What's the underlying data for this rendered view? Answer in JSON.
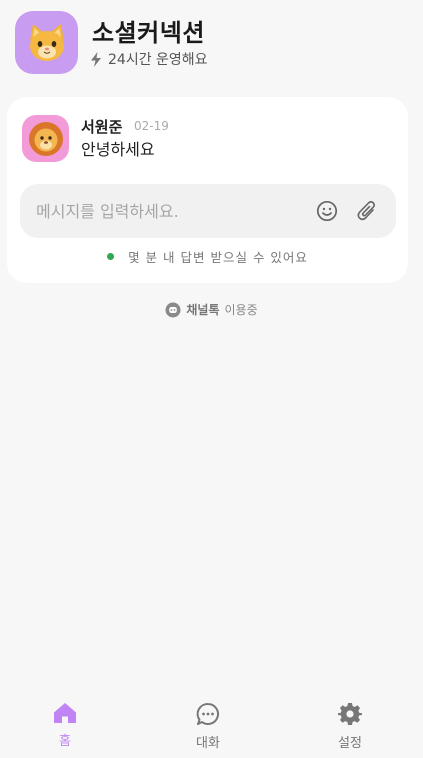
{
  "app": {
    "title": "소셜커넥션",
    "subtitle": "24시간 운영해요",
    "avatar_emoji": "🐱",
    "avatar_color": "#c89cf0"
  },
  "message": {
    "sender": "서원준",
    "date": "02-19",
    "text": "안녕하세요",
    "avatar_emoji": "🦁",
    "avatar_color": "#f29bd8"
  },
  "composer": {
    "placeholder": "메시지를 입력하세요.",
    "value": ""
  },
  "status": {
    "text": "몇 분 내 답변 받으실 수 있어요",
    "dot_color": "#2fa84f"
  },
  "powered_by": {
    "brand": "채널톡",
    "suffix": "이용중"
  },
  "nav": {
    "items": [
      {
        "label": "홈",
        "icon": "home-icon",
        "active": true
      },
      {
        "label": "대화",
        "icon": "chat-icon",
        "active": false
      },
      {
        "label": "설정",
        "icon": "gear-icon",
        "active": false
      }
    ],
    "active_color": "#c084f5"
  }
}
